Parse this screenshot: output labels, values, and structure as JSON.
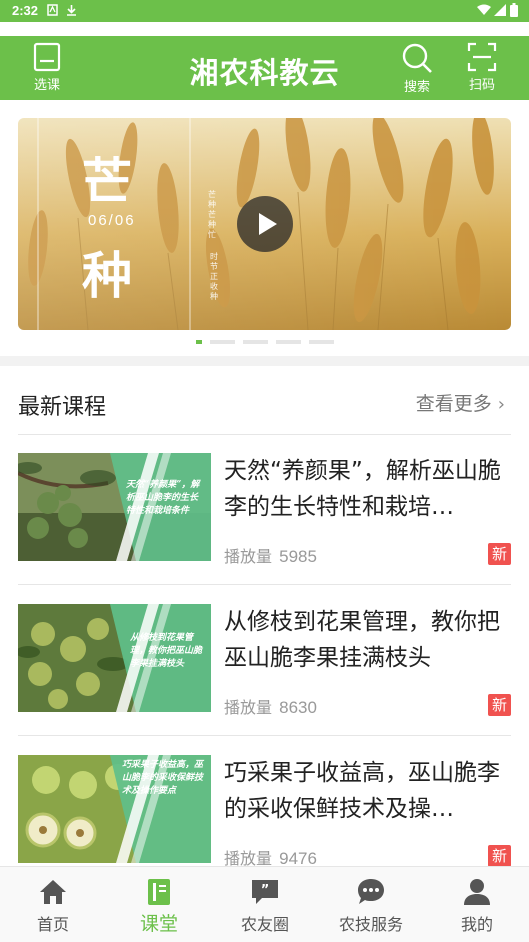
{
  "status_bar": {
    "time": "2:32"
  },
  "header": {
    "title": "湘农科教云",
    "left_button": {
      "label": "选课",
      "icon": "book-icon"
    },
    "search_button": {
      "label": "搜索",
      "icon": "search-icon"
    },
    "scan_button": {
      "label": "扫码",
      "icon": "scan-icon"
    }
  },
  "banner": {
    "title_line1": "芒",
    "title_line2": "种",
    "date": "06/06",
    "vertical_text_1": "芒种芒种忙",
    "vertical_text_2": "时节正收种",
    "slides_total": 5,
    "active_slide": 1
  },
  "section": {
    "title": "最新课程",
    "more_label": "查看更多",
    "more_chevron": "›"
  },
  "courses": [
    {
      "title": "天然“养颜果”，解析巫山脆李的生长特性和栽培…",
      "thumb_text": "天然“养颜果”，解析巫山脆李的生长特性和栽培条件",
      "plays_label": "播放量",
      "plays": "5985",
      "badge": "新"
    },
    {
      "title": "从修枝到花果管理，教你把巫山脆李果挂满枝头",
      "thumb_text": "从修枝到花果管理，教你把巫山脆李果挂满枝头",
      "plays_label": "播放量",
      "plays": "8630",
      "badge": "新"
    },
    {
      "title": "巧采果子收益高，巫山脆李的采收保鲜技术及操…",
      "thumb_text": "巧采果子收益高，巫山脆李的采收保鲜技术及操作要点",
      "plays_label": "播放量",
      "plays": "9476",
      "badge": "新"
    }
  ],
  "bottom_nav": [
    {
      "label": "首页",
      "icon": "home-icon",
      "active": false
    },
    {
      "label": "课堂",
      "icon": "classroom-icon",
      "active": true
    },
    {
      "label": "农友圈",
      "icon": "quote-bubble-icon",
      "active": false
    },
    {
      "label": "农技服务",
      "icon": "chat-dots-icon",
      "active": false
    },
    {
      "label": "我的",
      "icon": "user-icon",
      "active": false
    }
  ],
  "colors": {
    "brand_green": "#6cc04a",
    "badge_red": "#f0524f",
    "card_green": "#5fbf8a"
  }
}
